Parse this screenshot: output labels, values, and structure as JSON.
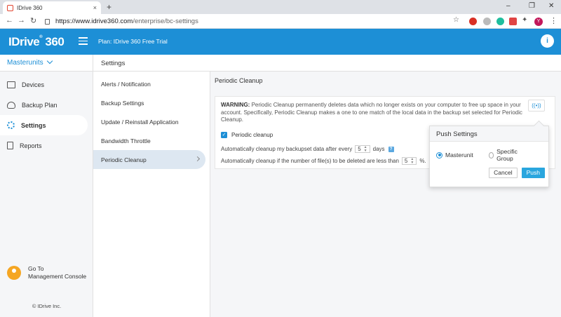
{
  "browser": {
    "tab_title": "IDrive 360",
    "tab_close": "×",
    "new_tab": "+",
    "url_host": "https://www.idrive360.com",
    "url_path": "/enterprise/bc-settings",
    "profile_initial": "Y",
    "win_min": "–",
    "win_restore": "❐",
    "win_close": "✕"
  },
  "header": {
    "logo_text": "IDrive",
    "logo_suffix": "360",
    "plan_label": "Plan: IDrive 360 Free Trial",
    "info_label": "i"
  },
  "sidebar": {
    "org_name": "Masterunits",
    "items": [
      {
        "label": "Devices"
      },
      {
        "label": "Backup Plan"
      },
      {
        "label": "Settings"
      },
      {
        "label": "Reports"
      }
    ],
    "console_line1": "Go To",
    "console_line2": "Management Console",
    "copyright": "© IDrive Inc."
  },
  "settings": {
    "header": "Settings",
    "menu": [
      {
        "label": "Alerts / Notification"
      },
      {
        "label": "Backup Settings"
      },
      {
        "label": "Update / Reinstall Application"
      },
      {
        "label": "Bandwidth Throttle"
      },
      {
        "label": "Periodic Cleanup"
      }
    ]
  },
  "cleanup": {
    "title": "Periodic Cleanup",
    "warning_label": "WARNING:",
    "warning_text": "Periodic Cleanup permanently deletes data which no longer exists on your computer to free up space in your account. Specifically, Periodic Cleanup makes a one to one match of the local data in the backup set selected for Periodic Cleanup.",
    "checkbox_label": "Periodic cleanup",
    "row1_prefix": "Automatically cleanup my backupset data after every",
    "row1_value": "5",
    "row1_suffix": "days",
    "help_label": "?",
    "row2_prefix": "Automatically cleanup if the number of file(s) to be deleted are less than",
    "row2_value": "5",
    "row2_suffix": "%."
  },
  "push": {
    "title": "Push Settings",
    "option1": "Masterunit",
    "option2": "Specific Group",
    "cancel": "Cancel",
    "push": "Push"
  }
}
